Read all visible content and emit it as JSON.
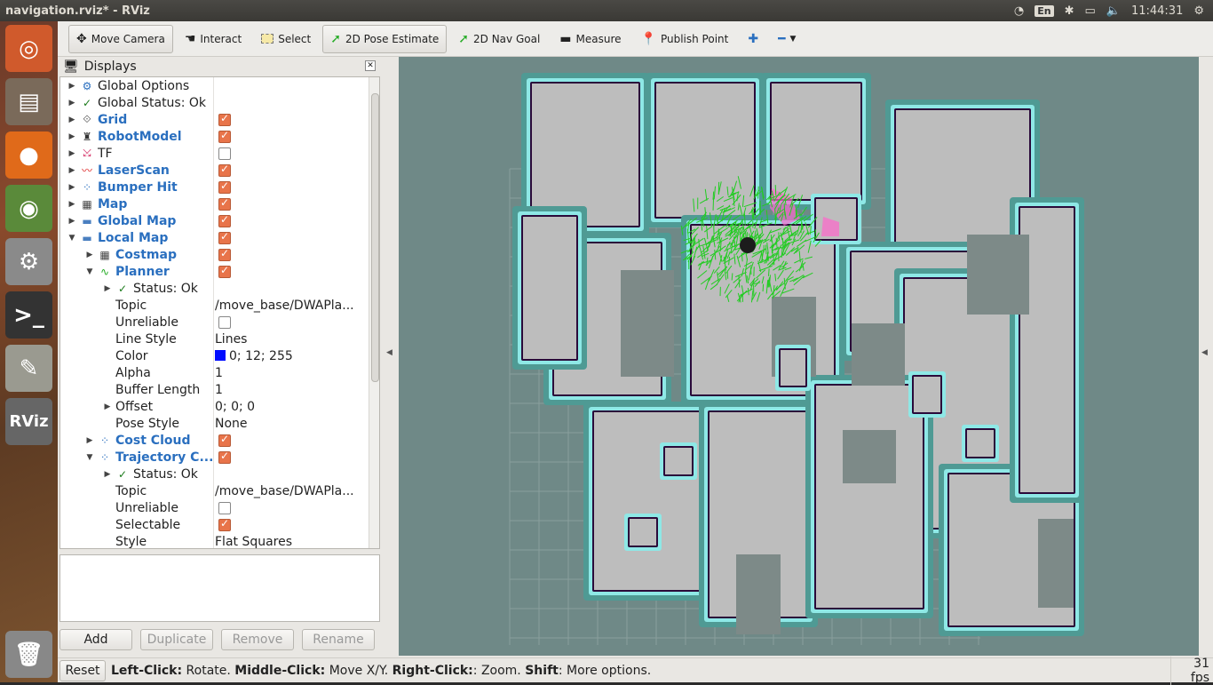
{
  "window": {
    "title": "navigation.rviz* - RViz"
  },
  "indicators": {
    "keyboard": "En",
    "time": "11:44:31"
  },
  "toolbar": {
    "move_camera": "Move Camera",
    "interact": "Interact",
    "select": "Select",
    "pose_estimate": "2D Pose Estimate",
    "nav_goal": "2D Nav Goal",
    "measure": "Measure",
    "publish_point": "Publish Point"
  },
  "displays": {
    "title": "Displays",
    "rows": [
      {
        "label": "Global Options",
        "level": 0,
        "arrow": "right",
        "icon": "gear",
        "bold": false
      },
      {
        "label": "Global Status: Ok",
        "level": 0,
        "arrow": "right",
        "icon": "check",
        "bold": false
      },
      {
        "label": "Grid",
        "level": 0,
        "arrow": "right",
        "icon": "grid",
        "bold": true,
        "checked": true
      },
      {
        "label": "RobotModel",
        "level": 0,
        "arrow": "right",
        "icon": "robot",
        "bold": true,
        "checked": true
      },
      {
        "label": "TF",
        "level": 0,
        "arrow": "right",
        "icon": "tf",
        "bold": false,
        "checked": false
      },
      {
        "label": "LaserScan",
        "level": 0,
        "arrow": "right",
        "icon": "laser",
        "bold": true,
        "checked": true
      },
      {
        "label": "Bumper Hit",
        "level": 0,
        "arrow": "right",
        "icon": "points",
        "bold": true,
        "checked": true
      },
      {
        "label": "Map",
        "level": 0,
        "arrow": "right",
        "icon": "map",
        "bold": true,
        "checked": true
      },
      {
        "label": "Global Map",
        "level": 0,
        "arrow": "right",
        "icon": "folder",
        "bold": true,
        "checked": true
      },
      {
        "label": "Local Map",
        "level": 0,
        "arrow": "down",
        "icon": "folder",
        "bold": true,
        "checked": true
      },
      {
        "label": "Costmap",
        "level": 1,
        "arrow": "right",
        "icon": "map",
        "bold": true,
        "checked": true
      },
      {
        "label": "Planner",
        "level": 1,
        "arrow": "down",
        "icon": "path",
        "bold": true,
        "checked": true
      },
      {
        "label": "Status: Ok",
        "level": 2,
        "arrow": "right",
        "icon": "check",
        "bold": false
      },
      {
        "label": "Topic",
        "level": 2,
        "value": "/move_base/DWAPla..."
      },
      {
        "label": "Unreliable",
        "level": 2,
        "checked": false
      },
      {
        "label": "Line Style",
        "level": 2,
        "value": "Lines"
      },
      {
        "label": "Color",
        "level": 2,
        "value": "0; 12; 255",
        "swatch": "#000cff"
      },
      {
        "label": "Alpha",
        "level": 2,
        "value": "1"
      },
      {
        "label": "Buffer Length",
        "level": 2,
        "value": "1"
      },
      {
        "label": "Offset",
        "level": 2,
        "arrow": "right",
        "value": "0; 0; 0"
      },
      {
        "label": "Pose Style",
        "level": 2,
        "value": "None"
      },
      {
        "label": "Cost Cloud",
        "level": 1,
        "arrow": "right",
        "icon": "points",
        "bold": true,
        "checked": true
      },
      {
        "label": "Trajectory C...",
        "level": 1,
        "arrow": "down",
        "icon": "points",
        "bold": true,
        "checked": true
      },
      {
        "label": "Status: Ok",
        "level": 2,
        "arrow": "right",
        "icon": "check",
        "bold": false
      },
      {
        "label": "Topic",
        "level": 2,
        "value": "/move_base/DWAPla..."
      },
      {
        "label": "Unreliable",
        "level": 2,
        "checked": false
      },
      {
        "label": "Selectable",
        "level": 2,
        "checked": true
      },
      {
        "label": "Style",
        "level": 2,
        "value": "Flat Squares"
      }
    ],
    "buttons": {
      "add": "Add",
      "duplicate": "Duplicate",
      "remove": "Remove",
      "rename": "Rename"
    }
  },
  "status": {
    "reset": "Reset",
    "b1": "Left-Click:",
    "t1": " Rotate. ",
    "b2": "Middle-Click:",
    "t2": " Move X/Y. ",
    "b3": "Right-Click:",
    "t3": ": Zoom. ",
    "b4": "Shift",
    "t4": ": More options.",
    "fps": "31 fps"
  },
  "colors": {
    "map_bg": "#6f8987",
    "free": "#bdbdbd",
    "inflation": "#8ee8e6",
    "obstacle": "#2a0a3a",
    "particles": "#22cc22",
    "accent": "#e8744a"
  }
}
